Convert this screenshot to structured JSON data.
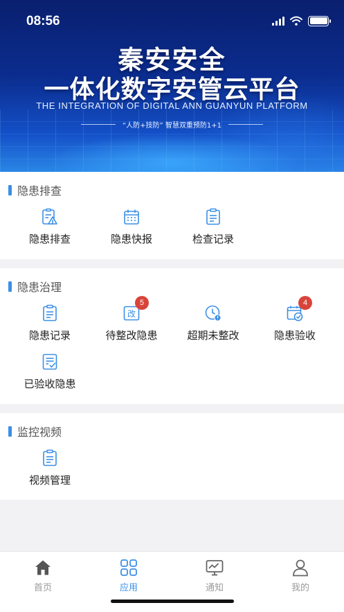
{
  "status_bar": {
    "time": "08:56"
  },
  "banner": {
    "title_line1": "秦安安全",
    "title_line2": "一体化数字安管云平台",
    "subtitle_en": "THE INTEGRATION OF DIGITAL ANN GUANYUN PLATFORM",
    "slogan": "“人防+技防” 智慧双重预防1+1"
  },
  "sections": {
    "inspection": {
      "title": "隐患排查",
      "items": [
        {
          "label": "隐患排查",
          "icon": "clipboard-warning-icon"
        },
        {
          "label": "隐患快报",
          "icon": "calendar-icon"
        },
        {
          "label": "检查记录",
          "icon": "clipboard-icon"
        }
      ]
    },
    "governance": {
      "title": "隐患治理",
      "items": [
        {
          "label": "隐患记录",
          "icon": "clipboard-icon"
        },
        {
          "label": "待整改隐患",
          "icon": "rectify-icon",
          "badge": "5"
        },
        {
          "label": "超期未整改",
          "icon": "clock-alert-icon"
        },
        {
          "label": "隐患验收",
          "icon": "calendar-check-icon",
          "badge": "4"
        },
        {
          "label": "已验收隐患",
          "icon": "document-check-icon"
        }
      ]
    },
    "monitoring": {
      "title": "监控视频",
      "items": [
        {
          "label": "视频管理",
          "icon": "clipboard-icon"
        }
      ]
    }
  },
  "tabbar": {
    "tabs": [
      {
        "label": "首页",
        "icon": "home-icon"
      },
      {
        "label": "应用",
        "icon": "grid-icon",
        "active": true
      },
      {
        "label": "通知",
        "icon": "monitor-icon"
      },
      {
        "label": "我的",
        "icon": "user-icon"
      }
    ]
  },
  "colors": {
    "accent": "#3b8fe6",
    "badge": "#d9443a",
    "background": "#f2f2f4"
  }
}
